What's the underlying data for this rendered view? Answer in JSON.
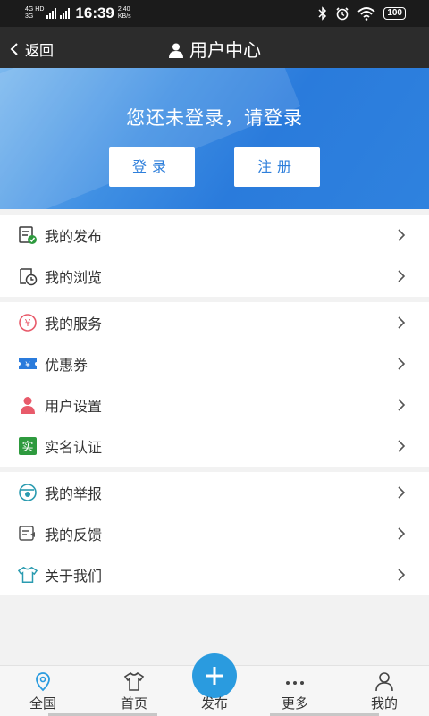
{
  "status_bar": {
    "network_top": "4G HD",
    "network_bottom": "3G",
    "time": "16:39",
    "speed_value": "2.40",
    "speed_unit": "KB/s",
    "battery": "100"
  },
  "header": {
    "back_label": "返回",
    "title": "用户中心"
  },
  "banner": {
    "prompt": "您还未登录，请登录",
    "login_label": "登录",
    "register_label": "注册"
  },
  "groups": [
    {
      "items": [
        {
          "label": "我的发布",
          "icon": "publish-icon"
        },
        {
          "label": "我的浏览",
          "icon": "history-icon"
        }
      ]
    },
    {
      "items": [
        {
          "label": "我的服务",
          "icon": "service-icon"
        },
        {
          "label": "优惠券",
          "icon": "coupon-icon"
        },
        {
          "label": "用户设置",
          "icon": "user-settings-icon"
        },
        {
          "label": "实名认证",
          "icon": "verify-icon"
        }
      ]
    },
    {
      "items": [
        {
          "label": "我的举报",
          "icon": "report-icon"
        },
        {
          "label": "我的反馈",
          "icon": "feedback-icon"
        },
        {
          "label": "关于我们",
          "icon": "about-icon"
        }
      ]
    }
  ],
  "verify_icon_char": "实",
  "service_icon_char": "¥",
  "coupon_icon_char": "¥",
  "tabbar": {
    "tabs": [
      {
        "label": "全国",
        "icon": "location-icon"
      },
      {
        "label": "首页",
        "icon": "shirt-icon"
      },
      {
        "label": "发布",
        "icon": "plus-icon"
      },
      {
        "label": "更多",
        "icon": "more-icon"
      },
      {
        "label": "我的",
        "icon": "profile-icon"
      }
    ],
    "active_index": 4
  },
  "colors": {
    "accent": "#2a9bdf",
    "banner": "#2f82de",
    "header": "#2c2c2c",
    "verify_green": "#2e9a3e",
    "user_red": "#e85a6a"
  }
}
